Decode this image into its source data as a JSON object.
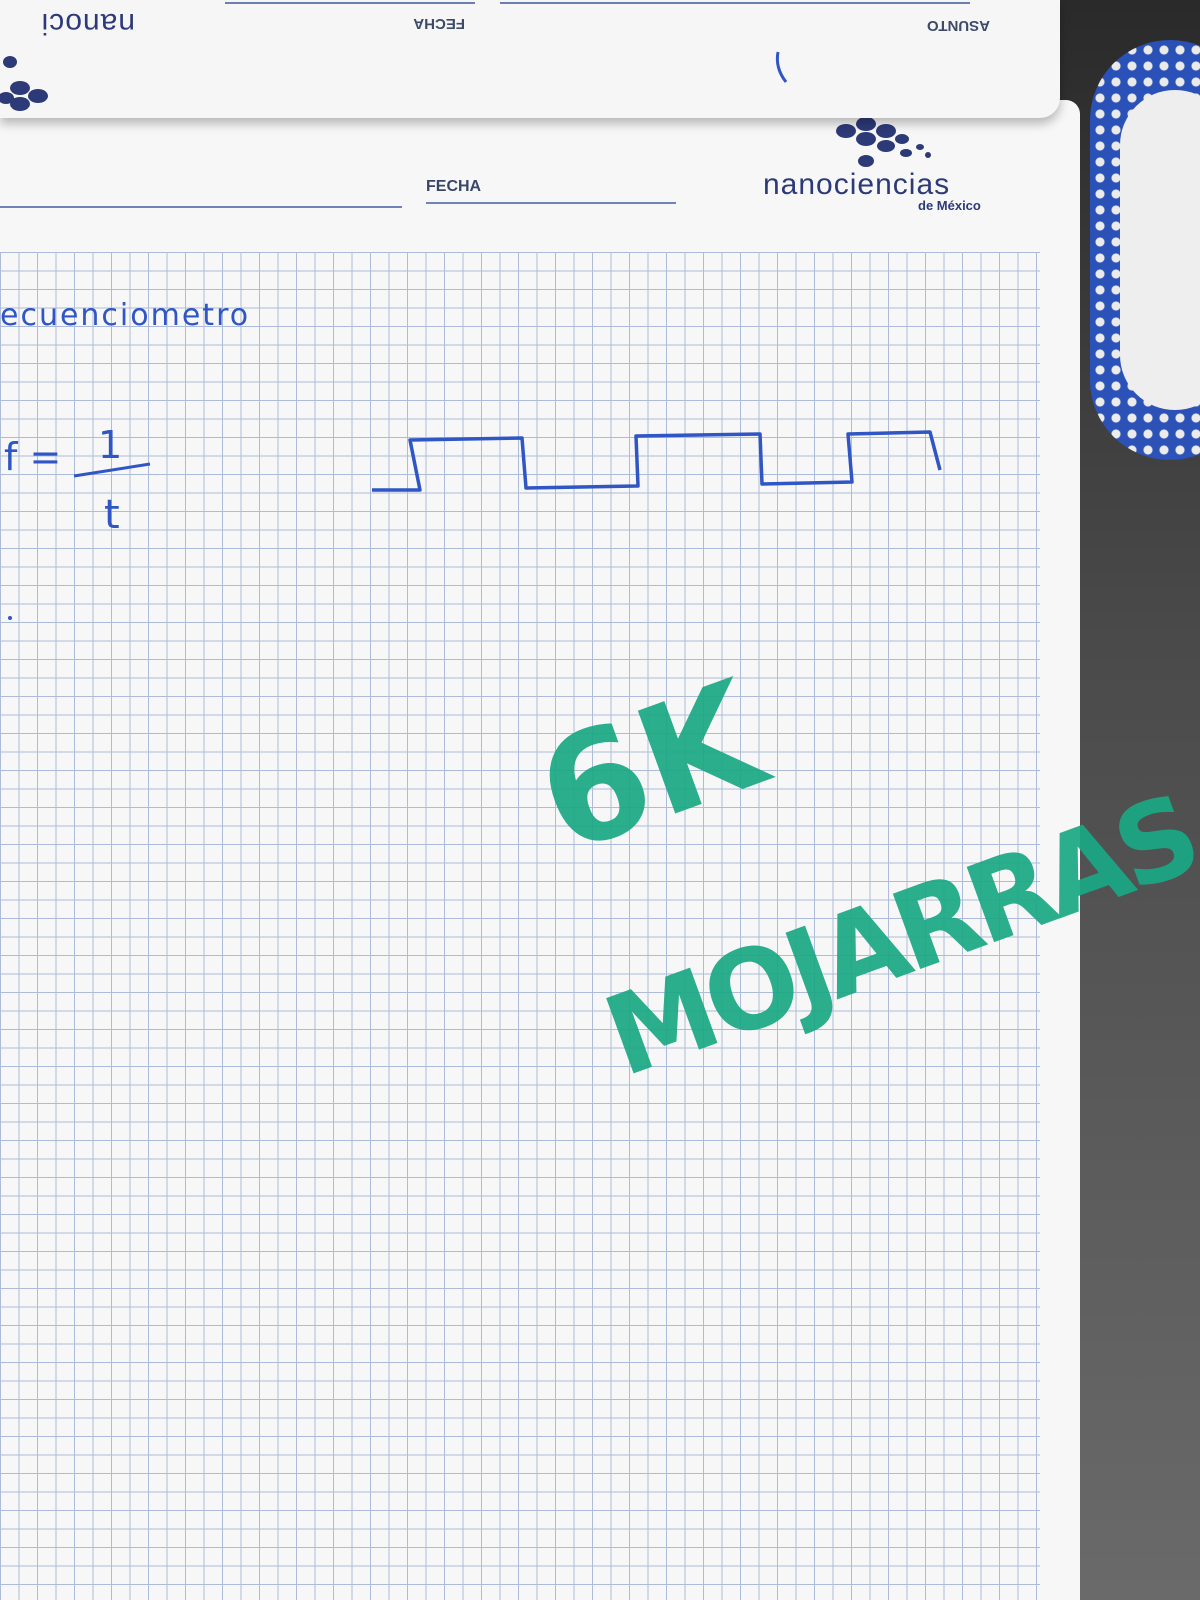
{
  "top_page": {
    "brand": "nanoci",
    "fecha_label": "FECHA",
    "asunto_label": "ASUNTO"
  },
  "header": {
    "fecha_label": "FECHA",
    "brand_name": "nanociencias",
    "brand_sub": "de México"
  },
  "notes": {
    "title": "ecuenciometro",
    "formula_f": "f =",
    "formula_num": "1",
    "formula_den": "t",
    "green_line1": "6K",
    "green_line2": "MOJARRAS"
  },
  "colors": {
    "paper": "#f7f7f7",
    "grid_lines": "#9fb2d6",
    "blue_ink": "#2f56c4",
    "green_marker": "#1aa884",
    "brand_blue": "#2d3a78"
  },
  "icons": [
    "hexagon-logo-icon"
  ]
}
